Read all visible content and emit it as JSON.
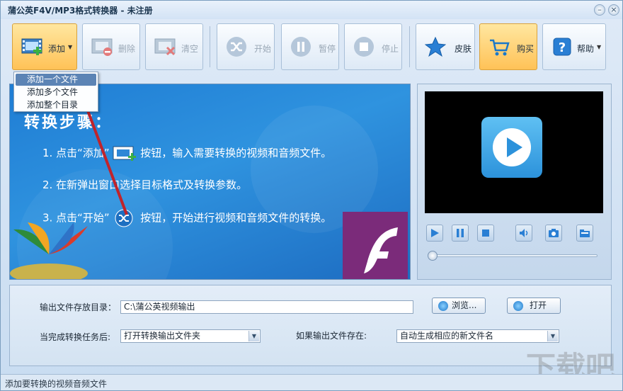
{
  "window": {
    "title": "蒲公英F4V/MP3格式转换器 - 未注册"
  },
  "toolbar": {
    "add_label": "添加",
    "delete_label": "删除",
    "clear_label": "清空",
    "start_label": "开始",
    "pause_label": "暂停",
    "stop_label": "停止",
    "skin_label": "皮肤",
    "buy_label": "购买",
    "help_label": "帮助"
  },
  "add_menu": {
    "items": [
      "添加一个文件",
      "添加多个文件",
      "添加整个目录"
    ],
    "highlighted_index": 0
  },
  "banner": {
    "heading": "转换步骤：",
    "steps": [
      {
        "text_before": "1. 点击“添加”",
        "text_after": "按钮，输入需要转换的视频和音频文件。"
      },
      {
        "text": "2. 在新弹出窗口选择目标格式及转换参数。"
      },
      {
        "text_before": "3. 点击“开始”",
        "text_after": "按钮，开始进行视频和音频文件的转换。"
      }
    ]
  },
  "player": {
    "progress": 0
  },
  "settings": {
    "output_dir_label": "输出文件存放目录：",
    "output_dir_value": "C:\\蒲公英视频输出",
    "browse_label": "浏览...",
    "open_label": "打开",
    "after_complete_label": "当完成转换任务后:",
    "after_complete_value": "打开转换输出文件夹",
    "if_exists_label": "如果输出文件存在:",
    "if_exists_value": "自动生成相应的新文件名"
  },
  "status": {
    "text": "添加要转换的视频音频文件"
  },
  "watermark": {
    "text": "下载吧"
  }
}
